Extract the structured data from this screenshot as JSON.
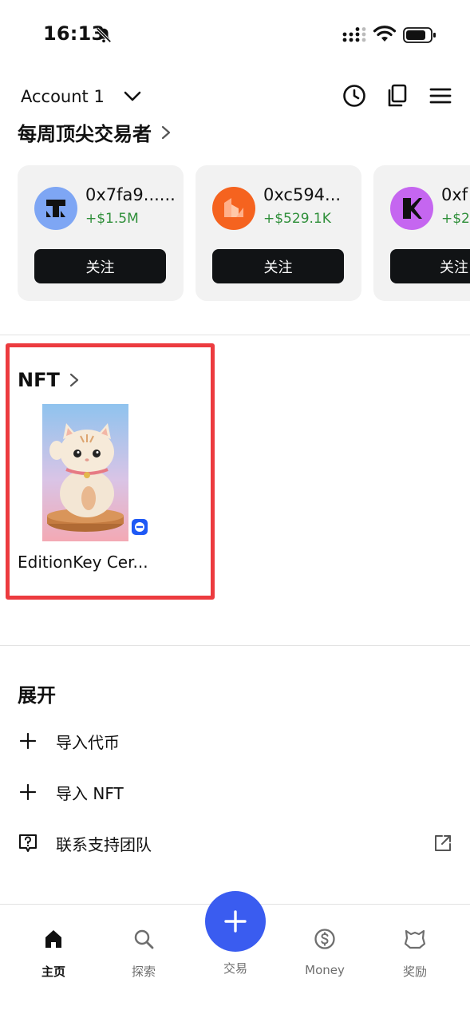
{
  "status_bar": {
    "time": "16:13"
  },
  "header": {
    "account_name": "Account 1"
  },
  "top_traders": {
    "title": "每周顶尖交易者",
    "cards": [
      {
        "address": "0x7fa9......",
        "pnl": "+$1.5M",
        "follow_label": "关注",
        "avatar_color": "#7ea6f4"
      },
      {
        "address": "0xc594...",
        "pnl": "+$529.1K",
        "follow_label": "关注",
        "avatar_color": "#f5631f"
      },
      {
        "address": "0xf",
        "pnl": "+$2",
        "follow_label": "关注",
        "avatar_color": "#c566f0"
      }
    ]
  },
  "nft": {
    "title": "NFT",
    "items": [
      {
        "name": "EditionKey Cer..."
      }
    ]
  },
  "expand": {
    "title": "展开",
    "actions": [
      {
        "label": "导入代币",
        "icon": "plus-icon"
      },
      {
        "label": "导入 NFT",
        "icon": "plus-icon"
      },
      {
        "label": "联系支持团队",
        "icon": "help-icon",
        "trailing_icon": "external-link-icon"
      }
    ]
  },
  "bottom_nav": {
    "items": [
      {
        "label": "主页",
        "icon": "home-icon",
        "active": true
      },
      {
        "label": "探索",
        "icon": "search-icon",
        "active": false
      },
      {
        "label": "交易",
        "icon": "plus-icon",
        "active": false
      },
      {
        "label": "Money",
        "icon": "dollar-circle-icon",
        "active": false
      },
      {
        "label": "奖励",
        "icon": "rewards-icon",
        "active": false
      }
    ]
  },
  "colors": {
    "accent_blue": "#3a5cf0",
    "positive_green": "#2f8f3a",
    "highlight_red": "#ec3b3f",
    "button_dark": "#111315"
  }
}
